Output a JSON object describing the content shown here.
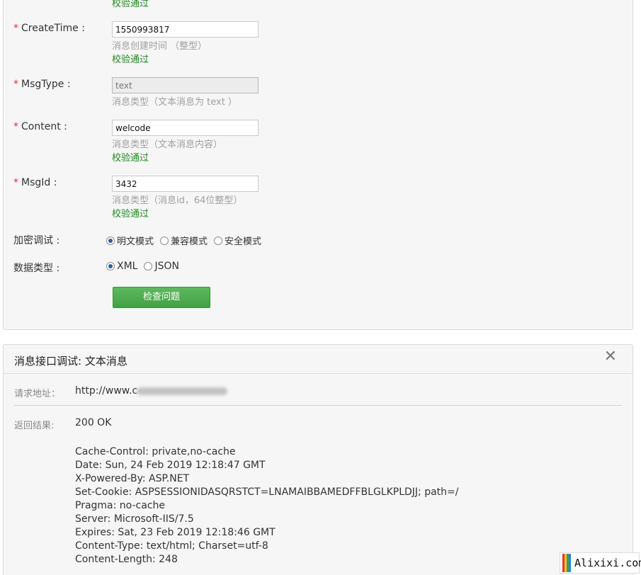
{
  "form": {
    "prev_status": "校验通过",
    "create_time": {
      "label": "CreateTime :",
      "value": "1550993817",
      "hint": "消息创建时间 （整型）",
      "status": "校验通过"
    },
    "msg_type": {
      "label": "MsgType :",
      "value": "text",
      "hint": "消息类型（文本消息为 text ）"
    },
    "content": {
      "label": "Content :",
      "value": "welcode",
      "hint": "消息类型（文本消息内容）",
      "status": "校验通过"
    },
    "msg_id": {
      "label": "MsgId :",
      "value": "3432",
      "hint": "消息类型（消息id，64位整型）",
      "status": "校验通过"
    },
    "encrypt": {
      "label": "加密调试 :",
      "options": [
        "明文模式",
        "兼容模式",
        "安全模式"
      ],
      "selected": "明文模式"
    },
    "data_type": {
      "label": "数据类型 :",
      "options": [
        "XML",
        "JSON"
      ],
      "selected": "XML"
    },
    "check_button": "检查问题"
  },
  "result_panel": {
    "title": "消息接口调试: 文本消息",
    "close_glyph": "✕",
    "request_label": "请求地址：",
    "request_url": "http://www.c",
    "result_label": "返回结果:",
    "status": "200 OK",
    "headers": [
      "Cache-Control: private,no-cache",
      "Date: Sun, 24 Feb 2019 12:18:47 GMT",
      "X-Powered-By: ASP.NET",
      "Set-Cookie: ASPSESSIONIDASQRSTCT=LNAMAIBBAMEDFFBLGLKPLDJJ; path=/",
      "Pragma: no-cache",
      "Server: Microsoft-IIS/7.5",
      "Expires: Sat, 23 Feb 2019 12:18:46 GMT",
      "Content-Type: text/html; Charset=utf-8",
      "Content-Length: 248"
    ]
  },
  "watermark": {
    "text": "Alixixi.com",
    "bar_colors": [
      "#e53935",
      "#fbc02d",
      "#43a047",
      "#1e88e5"
    ]
  },
  "colors": {
    "ok_green": "#1e8a1e",
    "required_red": "#d33333",
    "button_green": "#4caf50"
  }
}
